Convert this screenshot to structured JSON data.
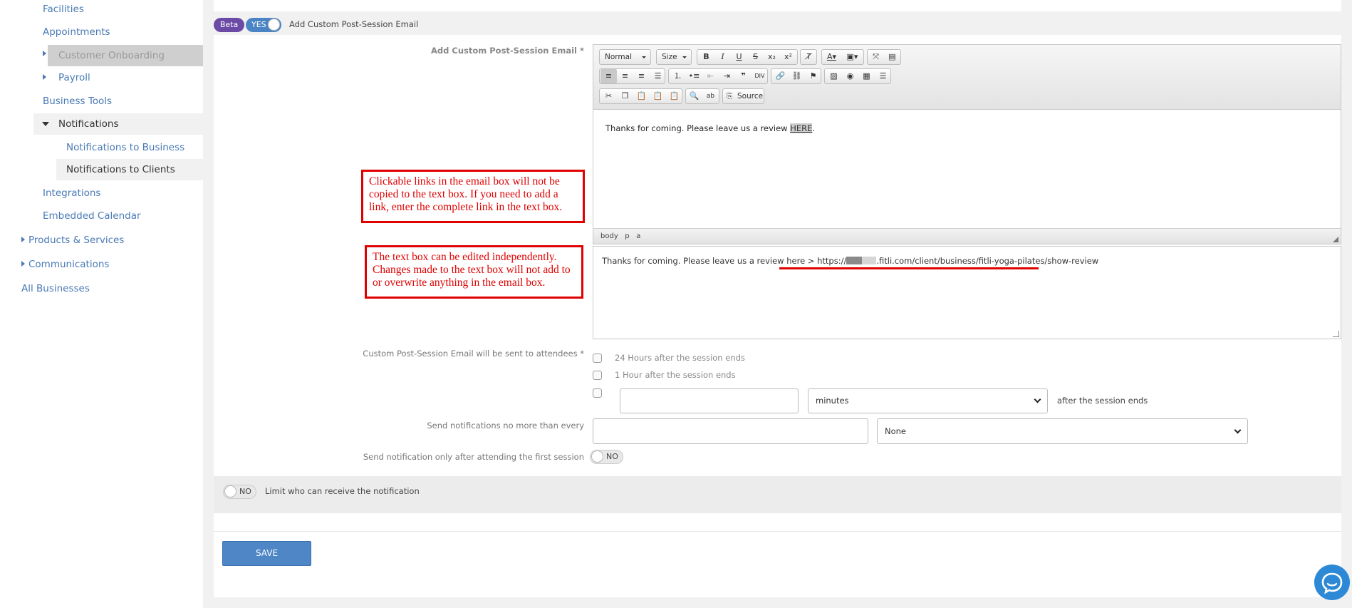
{
  "sidebar": {
    "items": [
      {
        "label": "Facilities"
      },
      {
        "label": "Appointments"
      },
      {
        "label": "Customer Onboarding"
      },
      {
        "label": "Payroll"
      },
      {
        "label": "Business Tools"
      },
      {
        "label": "Notifications"
      },
      {
        "label": "Notifications to Business"
      },
      {
        "label": "Notifications to Clients"
      },
      {
        "label": "Integrations"
      },
      {
        "label": "Embedded Calendar"
      },
      {
        "label": "Products & Services"
      },
      {
        "label": "Communications"
      },
      {
        "label": "All Businesses"
      }
    ]
  },
  "header": {
    "beta_badge": "Beta",
    "toggle_label": "YES",
    "title": "Add Custom Post-Session Email"
  },
  "editor": {
    "field_label": "Add Custom Post-Session Email *",
    "format_combo": "Normal",
    "size_combo": "Size",
    "source_label": "Source",
    "content_text": "Thanks for coming. Please leave us a review ",
    "content_link": "HERE",
    "content_end": ".",
    "path": [
      "body",
      "p",
      "a"
    ]
  },
  "textbox": {
    "text": "Thanks for coming. Please leave us a review here > ",
    "url_prefix": "https://",
    "url_suffix": ".fitli.com/client/business/fitli-yoga-pilates/show-review"
  },
  "callouts": {
    "first": "Clickable links in the email box will not be copied to the text box. If you need to add a link, enter the complete link in the text box.",
    "second": "The text box can be edited independently. Changes made to the text box will not add to or overwrite anything in the email box."
  },
  "schedule": {
    "label": "Custom Post-Session Email will be sent to attendees *",
    "option1": "24 Hours after the session ends",
    "option2": "1 Hour after the session ends",
    "unit_select": "minutes",
    "after_label": "after the session ends"
  },
  "frequency": {
    "label": "Send notifications no more than every",
    "select_value": "None"
  },
  "first_session": {
    "label": "Send notification only after attending the first session",
    "toggle": "NO"
  },
  "limit": {
    "toggle": "NO",
    "label": "Limit who can receive the notification"
  },
  "save_label": "SAVE"
}
